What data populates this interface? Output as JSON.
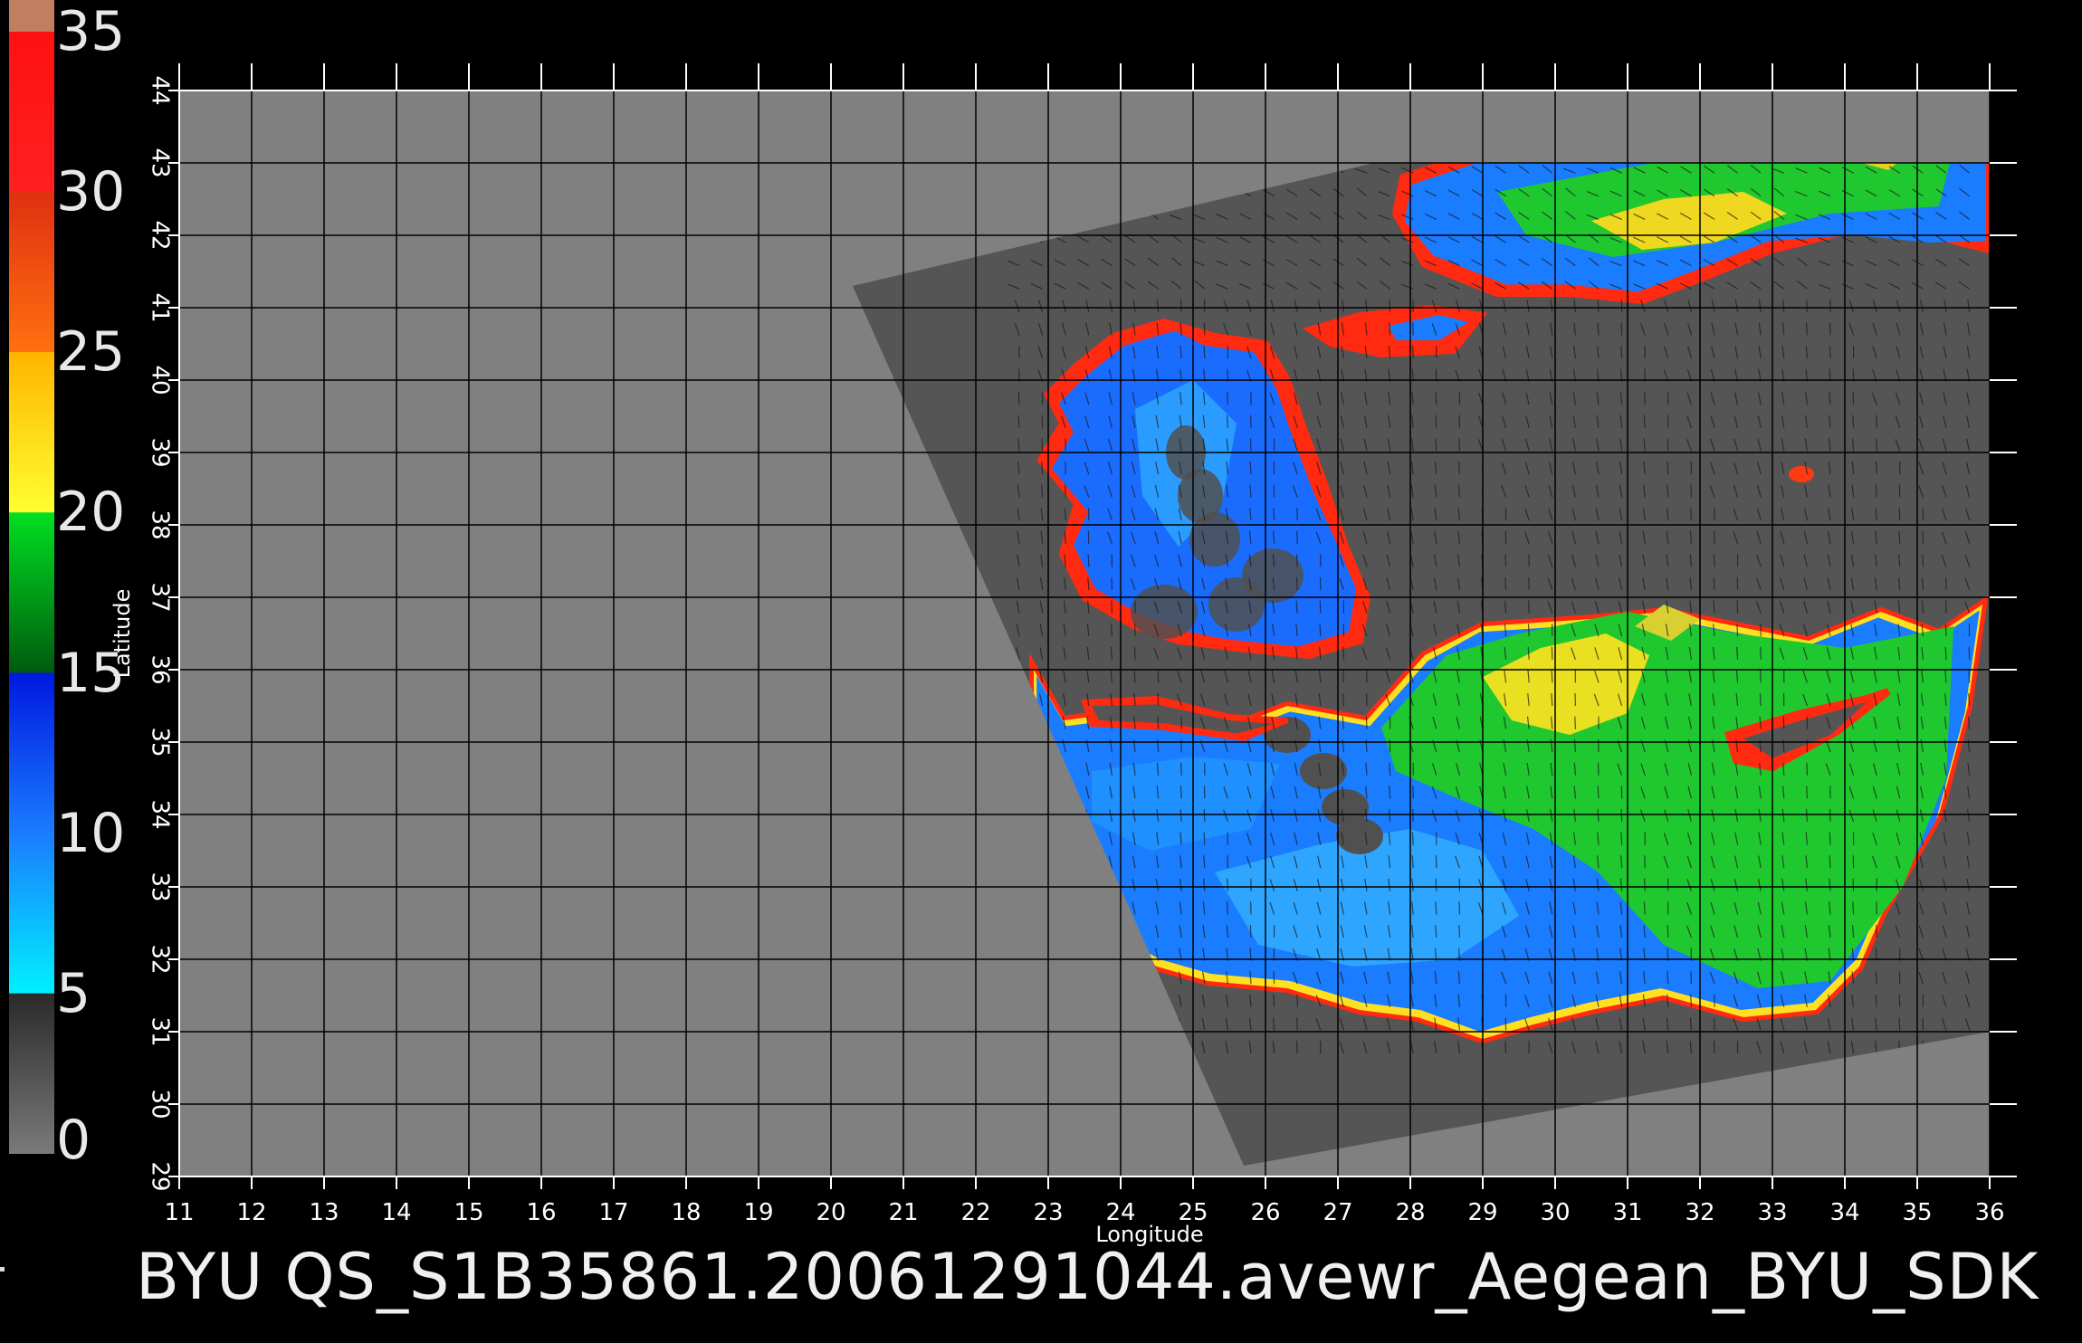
{
  "colorbar": {
    "ticks": [
      "35",
      "30",
      "25",
      "20",
      "15",
      "10",
      "5",
      "0"
    ],
    "tick_values": [
      35,
      30,
      25,
      20,
      15,
      10,
      5,
      0
    ],
    "range": [
      0,
      35
    ],
    "stops": [
      {
        "v": 0,
        "color": "#7a7a7a"
      },
      {
        "v": 5,
        "color": "#2a2a2a"
      },
      {
        "v": 5.01,
        "color": "#00f0ff"
      },
      {
        "v": 10,
        "color": "#1a7cff"
      },
      {
        "v": 15,
        "color": "#0018e0"
      },
      {
        "v": 15.01,
        "color": "#005a10"
      },
      {
        "v": 20,
        "color": "#00e020"
      },
      {
        "v": 20.01,
        "color": "#ffff30"
      },
      {
        "v": 25,
        "color": "#ffb400"
      },
      {
        "v": 25.01,
        "color": "#ff7010"
      },
      {
        "v": 30,
        "color": "#e03010"
      },
      {
        "v": 30.01,
        "color": "#ff2020"
      },
      {
        "v": 35,
        "color": "#ff1010"
      },
      {
        "v": 35.01,
        "color": "#c08060"
      }
    ]
  },
  "map": {
    "lon_range": [
      11,
      36
    ],
    "lat_range": [
      29,
      44
    ],
    "lon_ticks": [
      "11",
      "12",
      "13",
      "14",
      "15",
      "16",
      "17",
      "18",
      "19",
      "20",
      "21",
      "22",
      "23",
      "24",
      "25",
      "26",
      "27",
      "28",
      "29",
      "30",
      "31",
      "32",
      "33",
      "34",
      "35",
      "36"
    ],
    "lat_ticks": [
      "29",
      "30",
      "31",
      "32",
      "33",
      "34",
      "35",
      "36",
      "37",
      "38",
      "39",
      "40",
      "41",
      "42",
      "43",
      "44"
    ],
    "xlabel": "Longitude",
    "ylabel": "Latitude",
    "colors": {
      "background": "#000000",
      "no_data": "#808080",
      "swath_land": "#555555",
      "grid": "#000000",
      "tick": "#ffffff"
    },
    "swath_corners_lonlat": [
      [
        20.3,
        41.3
      ],
      [
        27.5,
        43
      ],
      [
        36,
        43
      ],
      [
        36,
        31
      ],
      [
        25.7,
        29.15
      ]
    ]
  },
  "footer": "BYU  QS_S1B35861.20061291044.avewr_Aegean_BYU_SDK"
}
